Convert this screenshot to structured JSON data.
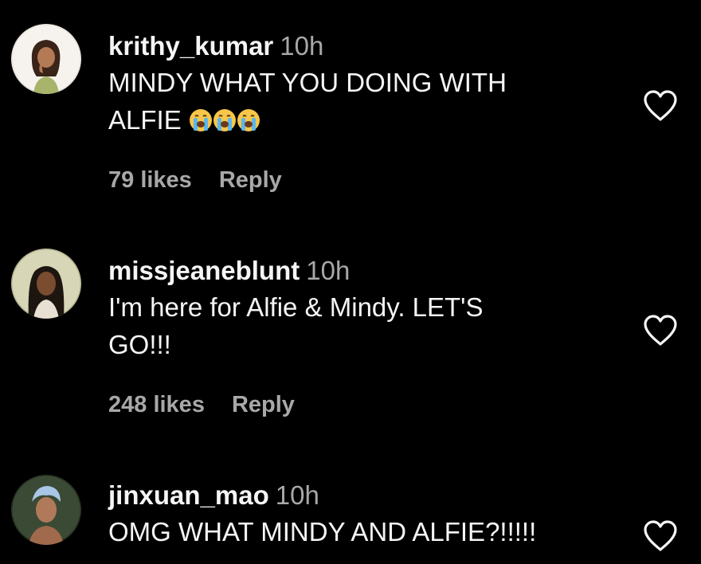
{
  "colors": {
    "background": "#000000",
    "primary_text": "#f5f5f5",
    "secondary_text": "#a8a8a8"
  },
  "comments": [
    {
      "username": "krithy_kumar",
      "time": "10h",
      "text_lines": [
        "MINDY WHAT YOU DOING WITH",
        "ALFIE"
      ],
      "emojis": [
        "loudly-crying-face",
        "loudly-crying-face",
        "loudly-crying-face"
      ],
      "likes": "79 likes",
      "reply": "Reply",
      "like_icon": "heart-outline-icon"
    },
    {
      "username": "missjeaneblunt",
      "time": "10h",
      "text_lines": [
        "I'm here for Alfie & Mindy. LET'S",
        "GO!!!"
      ],
      "likes": "248 likes",
      "reply": "Reply",
      "like_icon": "heart-outline-icon"
    },
    {
      "username": "jinxuan_mao",
      "time": "10h",
      "text_lines": [
        "OMG WHAT MINDY AND ALFIE?!!!!!"
      ],
      "like_icon": "heart-outline-icon"
    }
  ]
}
